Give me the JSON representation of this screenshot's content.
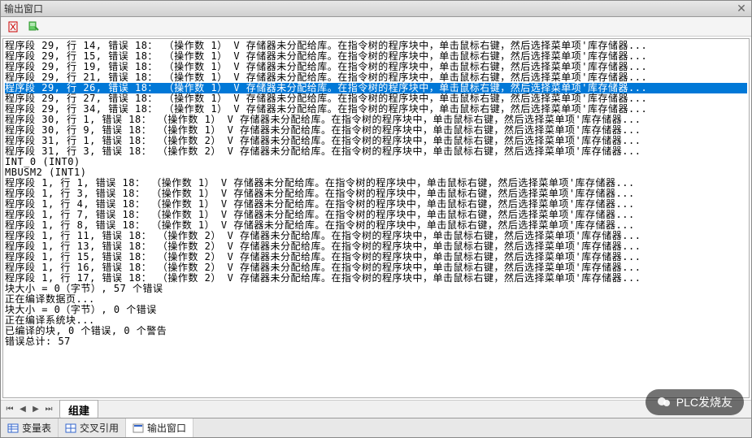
{
  "window": {
    "title": "输出窗口"
  },
  "output": {
    "lines": [
      {
        "text": "程序段 29, 行 14, 错误 18：   （操作数 1） V 存储器未分配给库。在指令树的程序块中，单击鼠标右键，然后选择菜单项'库存储器...",
        "selected": false
      },
      {
        "text": "程序段 29, 行 15, 错误 18：   （操作数 1） V 存储器未分配给库。在指令树的程序块中，单击鼠标右键，然后选择菜单项'库存储器...",
        "selected": false
      },
      {
        "text": "程序段 29, 行 19, 错误 18：   （操作数 1） V 存储器未分配给库。在指令树的程序块中，单击鼠标右键，然后选择菜单项'库存储器...",
        "selected": false
      },
      {
        "text": "程序段 29, 行 21, 错误 18：   （操作数 1） V 存储器未分配给库。在指令树的程序块中，单击鼠标右键，然后选择菜单项'库存储器...",
        "selected": false
      },
      {
        "text": "程序段 29, 行 26, 错误 18：   （操作数 1） V 存储器未分配给库。在指令树的程序块中，单击鼠标右键，然后选择菜单项'库存储器...",
        "selected": true
      },
      {
        "text": "程序段 29, 行 27, 错误 18：   （操作数 1） V 存储器未分配给库。在指令树的程序块中，单击鼠标右键，然后选择菜单项'库存储器...",
        "selected": false
      },
      {
        "text": "程序段 29, 行 34, 错误 18：   （操作数 1） V 存储器未分配给库。在指令树的程序块中，单击鼠标右键，然后选择菜单项'库存储器...",
        "selected": false
      },
      {
        "text": "程序段 30, 行 1, 错误 18：    （操作数 1） V 存储器未分配给库。在指令树的程序块中，单击鼠标右键，然后选择菜单项'库存储器...",
        "selected": false
      },
      {
        "text": "程序段 30, 行 9, 错误 18：    （操作数 1） V 存储器未分配给库。在指令树的程序块中，单击鼠标右键，然后选择菜单项'库存储器...",
        "selected": false
      },
      {
        "text": "程序段 31, 行 1, 错误 18：    （操作数 2） V 存储器未分配给库。在指令树的程序块中，单击鼠标右键，然后选择菜单项'库存储器...",
        "selected": false
      },
      {
        "text": "程序段 31, 行 3, 错误 18：    （操作数 2） V 存储器未分配给库。在指令树的程序块中，单击鼠标右键，然后选择菜单项'库存储器...",
        "selected": false
      },
      {
        "text": "INT_0 (INT0)",
        "selected": false
      },
      {
        "text": "MBUSM2 (INT1)",
        "selected": false
      },
      {
        "text": "程序段 1, 行 1, 错误 18：    （操作数 1） V 存储器未分配给库。在指令树的程序块中，单击鼠标右键，然后选择菜单项'库存储器...",
        "selected": false
      },
      {
        "text": "程序段 1, 行 3, 错误 18：    （操作数 1） V 存储器未分配给库。在指令树的程序块中，单击鼠标右键，然后选择菜单项'库存储器...",
        "selected": false
      },
      {
        "text": "程序段 1, 行 4, 错误 18：    （操作数 1） V 存储器未分配给库。在指令树的程序块中，单击鼠标右键，然后选择菜单项'库存储器...",
        "selected": false
      },
      {
        "text": "程序段 1, 行 7, 错误 18：    （操作数 1） V 存储器未分配给库。在指令树的程序块中，单击鼠标右键，然后选择菜单项'库存储器...",
        "selected": false
      },
      {
        "text": "程序段 1, 行 8, 错误 18：    （操作数 1） V 存储器未分配给库。在指令树的程序块中，单击鼠标右键，然后选择菜单项'库存储器...",
        "selected": false
      },
      {
        "text": "程序段 1, 行 11, 错误 18：    （操作数 2） V 存储器未分配给库。在指令树的程序块中，单击鼠标右键，然后选择菜单项'库存储器...",
        "selected": false
      },
      {
        "text": "程序段 1, 行 13, 错误 18：    （操作数 2） V 存储器未分配给库。在指令树的程序块中，单击鼠标右键，然后选择菜单项'库存储器...",
        "selected": false
      },
      {
        "text": "程序段 1, 行 15, 错误 18：    （操作数 2） V 存储器未分配给库。在指令树的程序块中，单击鼠标右键，然后选择菜单项'库存储器...",
        "selected": false
      },
      {
        "text": "程序段 1, 行 16, 错误 18：    （操作数 2） V 存储器未分配给库。在指令树的程序块中，单击鼠标右键，然后选择菜单项'库存储器...",
        "selected": false
      },
      {
        "text": "程序段 1, 行 17, 错误 18：    （操作数 2） V 存储器未分配给库。在指令树的程序块中，单击鼠标右键，然后选择菜单项'库存储器...",
        "selected": false
      },
      {
        "text": "块大小 = 0（字节）, 57 个错误",
        "selected": false
      },
      {
        "text": " ",
        "selected": false
      },
      {
        "text": "正在编译数据页...",
        "selected": false
      },
      {
        "text": "块大小 = 0（字节）, 0 个错误",
        "selected": false
      },
      {
        "text": " ",
        "selected": false
      },
      {
        "text": "正在编译系统块...",
        "selected": false
      },
      {
        "text": "已编译的块, 0 个错误, 0 个警告",
        "selected": false
      },
      {
        "text": " ",
        "selected": false
      },
      {
        "text": "错误总计: 57",
        "selected": false
      }
    ]
  },
  "tabs": {
    "build": "组建"
  },
  "bottomTabs": {
    "vartable": "变量表",
    "crossref": "交叉引用",
    "output": "输出窗口"
  },
  "watermark": {
    "text": "PLC发烧友"
  }
}
